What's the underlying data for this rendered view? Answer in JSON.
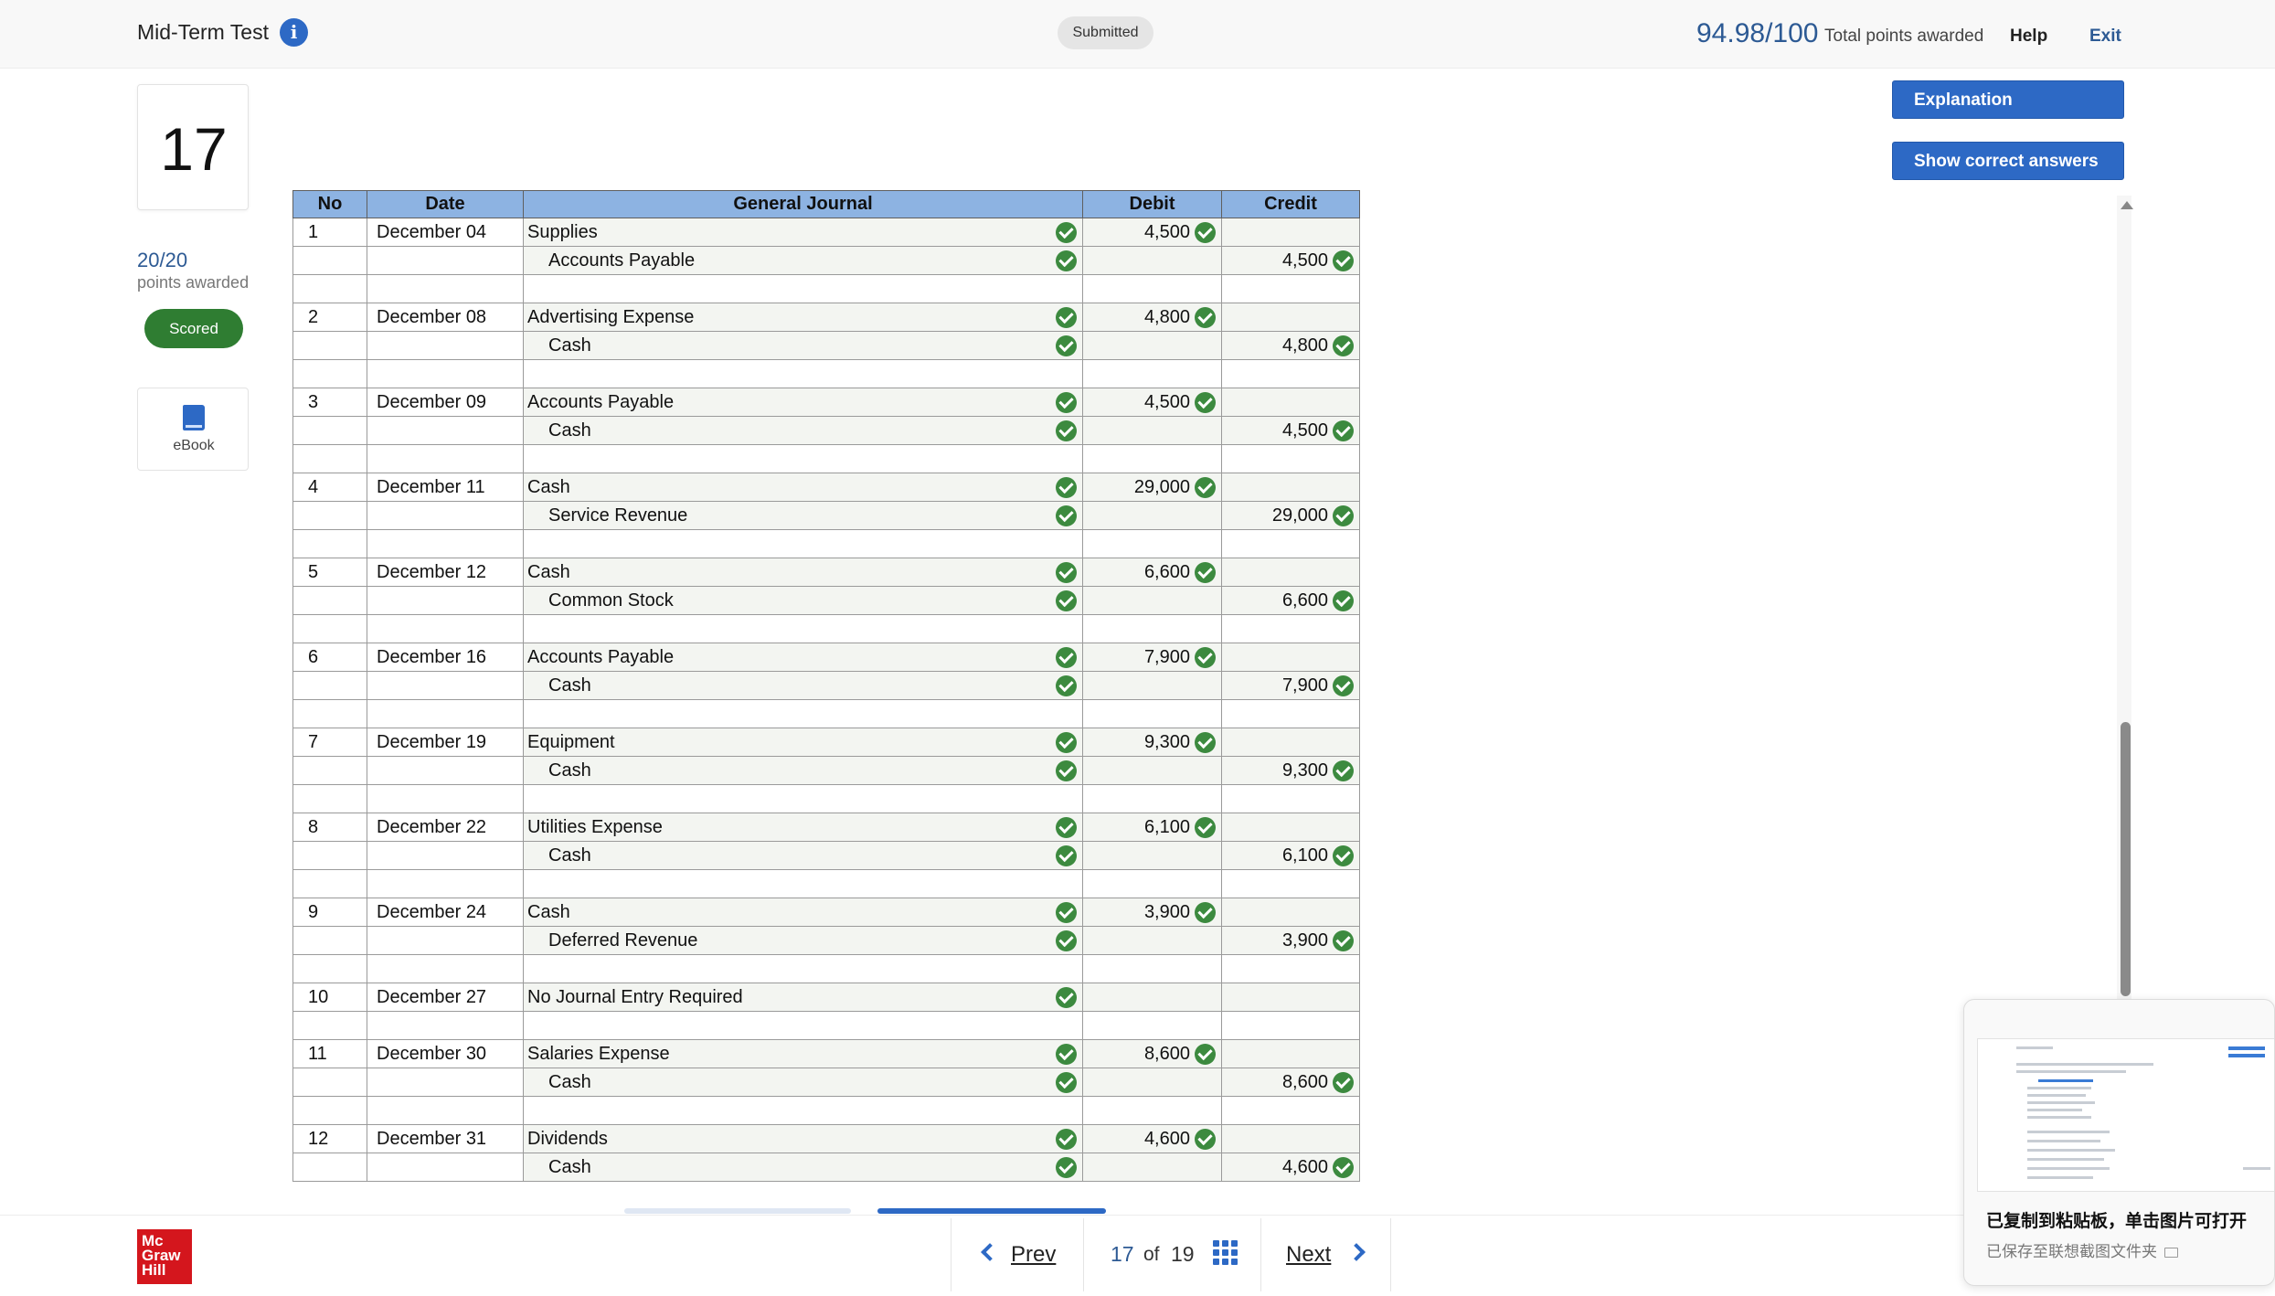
{
  "header": {
    "title": "Mid-Term Test",
    "status": "Submitted",
    "score": "94.98/100",
    "score_label": "Total points awarded",
    "help": "Help",
    "exit": "Exit"
  },
  "question": {
    "number": "17",
    "points": "20/20",
    "points_label": "points awarded",
    "status": "Scored",
    "ebook_label": "eBook"
  },
  "actions": {
    "explanation": "Explanation",
    "show_answers": "Show correct answers"
  },
  "journal": {
    "headers": {
      "no": "No",
      "date": "Date",
      "gj": "General Journal",
      "debit": "Debit",
      "credit": "Credit"
    },
    "entries": [
      {
        "no": "1",
        "date": "December 04",
        "debit_account": "Supplies",
        "debit": "4,500",
        "credit_account": "Accounts Payable",
        "credit": "4,500"
      },
      {
        "no": "2",
        "date": "December 08",
        "debit_account": "Advertising Expense",
        "debit": "4,800",
        "credit_account": "Cash",
        "credit": "4,800"
      },
      {
        "no": "3",
        "date": "December 09",
        "debit_account": "Accounts Payable",
        "debit": "4,500",
        "credit_account": "Cash",
        "credit": "4,500"
      },
      {
        "no": "4",
        "date": "December 11",
        "debit_account": "Cash",
        "debit": "29,000",
        "credit_account": "Service Revenue",
        "credit": "29,000"
      },
      {
        "no": "5",
        "date": "December 12",
        "debit_account": "Cash",
        "debit": "6,600",
        "credit_account": "Common Stock",
        "credit": "6,600"
      },
      {
        "no": "6",
        "date": "December 16",
        "debit_account": "Accounts Payable",
        "debit": "7,900",
        "credit_account": "Cash",
        "credit": "7,900"
      },
      {
        "no": "7",
        "date": "December 19",
        "debit_account": "Equipment",
        "debit": "9,300",
        "credit_account": "Cash",
        "credit": "9,300"
      },
      {
        "no": "8",
        "date": "December 22",
        "debit_account": "Utilities Expense",
        "debit": "6,100",
        "credit_account": "Cash",
        "credit": "6,100"
      },
      {
        "no": "9",
        "date": "December 24",
        "debit_account": "Cash",
        "debit": "3,900",
        "credit_account": "Deferred Revenue",
        "credit": "3,900"
      },
      {
        "no": "10",
        "date": "December 27",
        "debit_account": "No Journal Entry Required",
        "debit": "",
        "credit_account": "",
        "credit": ""
      },
      {
        "no": "11",
        "date": "December 30",
        "debit_account": "Salaries Expense",
        "debit": "8,600",
        "credit_account": "Cash",
        "credit": "8,600"
      },
      {
        "no": "12",
        "date": "December 31",
        "debit_account": "Dividends",
        "debit": "4,600",
        "credit_account": "Cash",
        "credit": "4,600"
      }
    ]
  },
  "footer": {
    "logo_text": "Mc Graw Hill",
    "prev": "Prev",
    "current_page": "17",
    "of": "of",
    "total_pages": "19",
    "next": "Next"
  },
  "toast": {
    "title": "已复制到粘贴板，单击图片可打开",
    "subtitle": "已保存至联想截图文件夹"
  },
  "colors": {
    "accent": "#2d69c5",
    "score_text": "#2d5a94",
    "header_fill": "#8db3e2",
    "correct_green": "#3c8a3f",
    "scored_badge": "#2f7d32",
    "brand_red": "#d4161d"
  },
  "icons": {
    "info": "info-icon",
    "check": "check-circle-icon",
    "ebook": "book-icon",
    "prev": "chevron-left-icon",
    "next": "chevron-right-icon",
    "grid": "grid-icon",
    "folder": "folder-icon"
  }
}
